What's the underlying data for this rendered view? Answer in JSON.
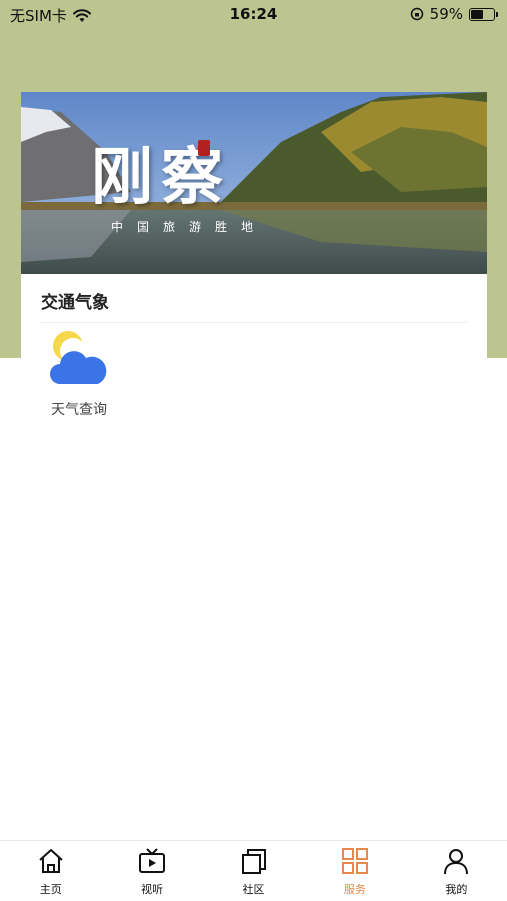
{
  "status_bar": {
    "carrier": "无SIM卡",
    "time": "16:24",
    "battery_percent": "59%",
    "battery_level": 0.59
  },
  "banner": {
    "title": "刚察",
    "subtitle": "中国旅游胜地"
  },
  "section": {
    "title": "交通气象"
  },
  "services": [
    {
      "label": "天气查询",
      "icon": "weather-icon"
    }
  ],
  "tab_bar": {
    "active_index": 3,
    "active_color": "#e8894a",
    "items": [
      {
        "label": "主页",
        "icon": "home-icon"
      },
      {
        "label": "视听",
        "icon": "tv-icon"
      },
      {
        "label": "社区",
        "icon": "community-icon"
      },
      {
        "label": "服务",
        "icon": "grid-icon"
      },
      {
        "label": "我的",
        "icon": "user-icon"
      }
    ]
  },
  "colors": {
    "header_bg": "#bcc590",
    "weather_cloud": "#3b74e6",
    "weather_sun": "#f5d84b"
  }
}
